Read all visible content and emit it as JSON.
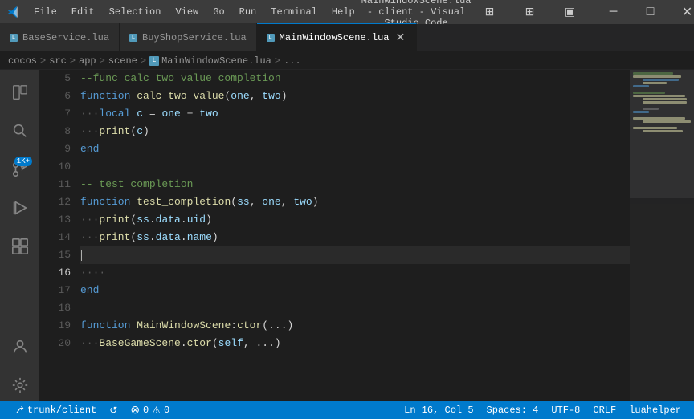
{
  "titleBar": {
    "title": "MainWindowScene.lua - client - Visual Studio Code",
    "menuItems": [
      "File",
      "Edit",
      "Selection",
      "View",
      "Go",
      "Run",
      "Terminal",
      "Help"
    ],
    "windowControls": [
      "─",
      "□",
      "✕"
    ]
  },
  "tabs": [
    {
      "id": "base",
      "label": "BaseService.lua",
      "active": false,
      "dirty": false
    },
    {
      "id": "buy",
      "label": "BuyShopService.lua",
      "active": false,
      "dirty": false
    },
    {
      "id": "main",
      "label": "MainWindowScene.lua",
      "active": true,
      "dirty": false
    }
  ],
  "breadcrumb": {
    "parts": [
      "cocos",
      "src",
      "app",
      "scene",
      "MainWindowScene.lua",
      "..."
    ]
  },
  "activityBar": {
    "icons": [
      {
        "id": "explorer",
        "symbol": "⎘",
        "active": false
      },
      {
        "id": "search",
        "symbol": "🔍",
        "active": false
      },
      {
        "id": "source-control",
        "symbol": "⎇",
        "active": false,
        "badge": "1K+"
      },
      {
        "id": "debug",
        "symbol": "▷",
        "active": false
      },
      {
        "id": "extensions",
        "symbol": "⊞",
        "active": false
      }
    ],
    "bottomIcons": [
      {
        "id": "remote",
        "symbol": "⚙"
      }
    ]
  },
  "editor": {
    "filename": "MainWindowScene.lua",
    "lines": [
      {
        "num": 5,
        "tokens": [
          {
            "t": "cmt",
            "v": "--func calc two value completion"
          }
        ]
      },
      {
        "num": 6,
        "tokens": [
          {
            "t": "kw",
            "v": "function"
          },
          {
            "t": "plain",
            "v": " "
          },
          {
            "t": "fn",
            "v": "calc_two_value"
          },
          {
            "t": "punc",
            "v": "("
          },
          {
            "t": "param",
            "v": "one"
          },
          {
            "t": "punc",
            "v": ", "
          },
          {
            "t": "param",
            "v": "two"
          },
          {
            "t": "punc",
            "v": ")"
          }
        ]
      },
      {
        "num": 7,
        "tokens": [
          {
            "t": "dots",
            "v": "···"
          },
          {
            "t": "kw",
            "v": "local"
          },
          {
            "t": "plain",
            "v": " "
          },
          {
            "t": "var",
            "v": "c"
          },
          {
            "t": "op",
            "v": " = "
          },
          {
            "t": "var",
            "v": "one"
          },
          {
            "t": "op",
            "v": " + "
          },
          {
            "t": "var",
            "v": "two"
          }
        ]
      },
      {
        "num": 8,
        "tokens": [
          {
            "t": "dots",
            "v": "···"
          },
          {
            "t": "fn",
            "v": "print"
          },
          {
            "t": "punc",
            "v": "("
          },
          {
            "t": "var",
            "v": "c"
          },
          {
            "t": "punc",
            "v": ")"
          }
        ]
      },
      {
        "num": 9,
        "tokens": [
          {
            "t": "kw",
            "v": "end"
          }
        ]
      },
      {
        "num": 10,
        "tokens": []
      },
      {
        "num": 11,
        "tokens": [
          {
            "t": "cmt",
            "v": "-- test completion"
          }
        ]
      },
      {
        "num": 12,
        "tokens": [
          {
            "t": "kw",
            "v": "function"
          },
          {
            "t": "plain",
            "v": " "
          },
          {
            "t": "fn",
            "v": "test_completion"
          },
          {
            "t": "punc",
            "v": "("
          },
          {
            "t": "param",
            "v": "ss"
          },
          {
            "t": "punc",
            "v": ", "
          },
          {
            "t": "param",
            "v": "one"
          },
          {
            "t": "punc",
            "v": ", "
          },
          {
            "t": "param",
            "v": "two"
          },
          {
            "t": "punc",
            "v": ")"
          }
        ]
      },
      {
        "num": 13,
        "tokens": [
          {
            "t": "dots",
            "v": "···"
          },
          {
            "t": "fn",
            "v": "print"
          },
          {
            "t": "punc",
            "v": "("
          },
          {
            "t": "var",
            "v": "ss"
          },
          {
            "t": "punc",
            "v": "."
          },
          {
            "t": "prop",
            "v": "data"
          },
          {
            "t": "punc",
            "v": "."
          },
          {
            "t": "prop",
            "v": "uid"
          },
          {
            "t": "punc",
            "v": ")"
          }
        ]
      },
      {
        "num": 14,
        "tokens": [
          {
            "t": "dots",
            "v": "···"
          },
          {
            "t": "fn",
            "v": "print"
          },
          {
            "t": "punc",
            "v": "("
          },
          {
            "t": "var",
            "v": "ss"
          },
          {
            "t": "punc",
            "v": "."
          },
          {
            "t": "prop",
            "v": "data"
          },
          {
            "t": "punc",
            "v": "."
          },
          {
            "t": "prop",
            "v": "name"
          },
          {
            "t": "punc",
            "v": ")"
          }
        ]
      },
      {
        "num": 15,
        "tokens": [],
        "cursor": true
      },
      {
        "num": 16,
        "tokens": [
          {
            "t": "dots",
            "v": "····"
          }
        ]
      },
      {
        "num": 17,
        "tokens": [
          {
            "t": "kw",
            "v": "end"
          }
        ]
      },
      {
        "num": 18,
        "tokens": []
      },
      {
        "num": 19,
        "tokens": [
          {
            "t": "kw",
            "v": "function"
          },
          {
            "t": "plain",
            "v": " "
          },
          {
            "t": "fn",
            "v": "MainWindowScene"
          },
          {
            "t": "punc",
            "v": ":"
          },
          {
            "t": "fn",
            "v": "ctor"
          },
          {
            "t": "punc",
            "v": "("
          },
          {
            "t": "plain",
            "v": "..."
          },
          {
            "t": "punc",
            "v": ")"
          }
        ]
      },
      {
        "num": 20,
        "tokens": [
          {
            "t": "dots",
            "v": "···"
          },
          {
            "t": "fn",
            "v": "BaseGameScene"
          },
          {
            "t": "punc",
            "v": "."
          },
          {
            "t": "fn",
            "v": "ctor"
          },
          {
            "t": "punc",
            "v": "("
          },
          {
            "t": "var",
            "v": "self"
          },
          {
            "t": "punc",
            "v": ", "
          },
          {
            "t": "plain",
            "v": "..."
          },
          {
            "t": "punc",
            "v": ")"
          }
        ]
      }
    ],
    "cursorLine": 16,
    "cursorCol": 5
  },
  "statusBar": {
    "left": [
      {
        "id": "branch",
        "icon": "⎇",
        "text": "trunk/client"
      },
      {
        "id": "sync",
        "icon": "↺",
        "text": ""
      },
      {
        "id": "errors",
        "icon": "⊗",
        "text": "0"
      },
      {
        "id": "warnings",
        "icon": "⚠",
        "text": "0"
      }
    ],
    "right": [
      {
        "id": "cursor-pos",
        "text": "Ln 16, Col 5"
      },
      {
        "id": "spaces",
        "text": "Spaces: 4"
      },
      {
        "id": "encoding",
        "text": "UTF-8"
      },
      {
        "id": "eol",
        "text": "CRLF"
      },
      {
        "id": "language",
        "text": "luahelper"
      }
    ]
  }
}
